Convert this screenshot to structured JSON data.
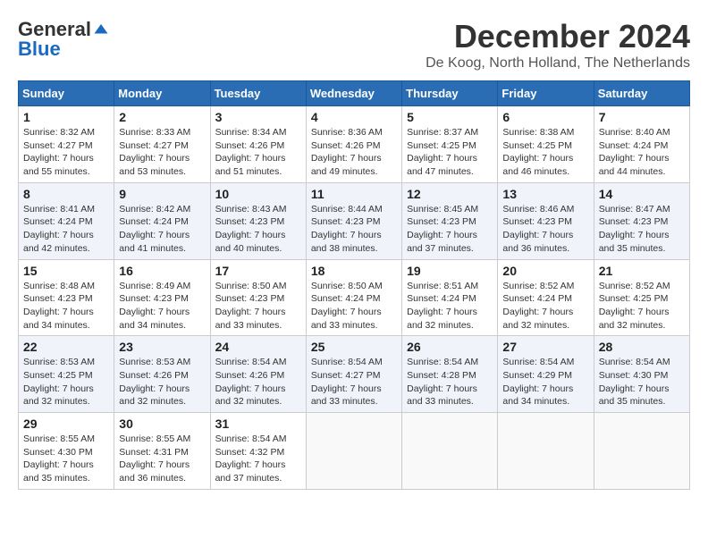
{
  "logo": {
    "general": "General",
    "blue": "Blue"
  },
  "header": {
    "title": "December 2024",
    "subtitle": "De Koog, North Holland, The Netherlands"
  },
  "weekdays": [
    "Sunday",
    "Monday",
    "Tuesday",
    "Wednesday",
    "Thursday",
    "Friday",
    "Saturday"
  ],
  "weeks": [
    [
      {
        "day": "1",
        "sunrise": "8:32 AM",
        "sunset": "4:27 PM",
        "daylight": "7 hours and 55 minutes."
      },
      {
        "day": "2",
        "sunrise": "8:33 AM",
        "sunset": "4:27 PM",
        "daylight": "7 hours and 53 minutes."
      },
      {
        "day": "3",
        "sunrise": "8:34 AM",
        "sunset": "4:26 PM",
        "daylight": "7 hours and 51 minutes."
      },
      {
        "day": "4",
        "sunrise": "8:36 AM",
        "sunset": "4:26 PM",
        "daylight": "7 hours and 49 minutes."
      },
      {
        "day": "5",
        "sunrise": "8:37 AM",
        "sunset": "4:25 PM",
        "daylight": "7 hours and 47 minutes."
      },
      {
        "day": "6",
        "sunrise": "8:38 AM",
        "sunset": "4:25 PM",
        "daylight": "7 hours and 46 minutes."
      },
      {
        "day": "7",
        "sunrise": "8:40 AM",
        "sunset": "4:24 PM",
        "daylight": "7 hours and 44 minutes."
      }
    ],
    [
      {
        "day": "8",
        "sunrise": "8:41 AM",
        "sunset": "4:24 PM",
        "daylight": "7 hours and 42 minutes."
      },
      {
        "day": "9",
        "sunrise": "8:42 AM",
        "sunset": "4:24 PM",
        "daylight": "7 hours and 41 minutes."
      },
      {
        "day": "10",
        "sunrise": "8:43 AM",
        "sunset": "4:23 PM",
        "daylight": "7 hours and 40 minutes."
      },
      {
        "day": "11",
        "sunrise": "8:44 AM",
        "sunset": "4:23 PM",
        "daylight": "7 hours and 38 minutes."
      },
      {
        "day": "12",
        "sunrise": "8:45 AM",
        "sunset": "4:23 PM",
        "daylight": "7 hours and 37 minutes."
      },
      {
        "day": "13",
        "sunrise": "8:46 AM",
        "sunset": "4:23 PM",
        "daylight": "7 hours and 36 minutes."
      },
      {
        "day": "14",
        "sunrise": "8:47 AM",
        "sunset": "4:23 PM",
        "daylight": "7 hours and 35 minutes."
      }
    ],
    [
      {
        "day": "15",
        "sunrise": "8:48 AM",
        "sunset": "4:23 PM",
        "daylight": "7 hours and 34 minutes."
      },
      {
        "day": "16",
        "sunrise": "8:49 AM",
        "sunset": "4:23 PM",
        "daylight": "7 hours and 34 minutes."
      },
      {
        "day": "17",
        "sunrise": "8:50 AM",
        "sunset": "4:23 PM",
        "daylight": "7 hours and 33 minutes."
      },
      {
        "day": "18",
        "sunrise": "8:50 AM",
        "sunset": "4:24 PM",
        "daylight": "7 hours and 33 minutes."
      },
      {
        "day": "19",
        "sunrise": "8:51 AM",
        "sunset": "4:24 PM",
        "daylight": "7 hours and 32 minutes."
      },
      {
        "day": "20",
        "sunrise": "8:52 AM",
        "sunset": "4:24 PM",
        "daylight": "7 hours and 32 minutes."
      },
      {
        "day": "21",
        "sunrise": "8:52 AM",
        "sunset": "4:25 PM",
        "daylight": "7 hours and 32 minutes."
      }
    ],
    [
      {
        "day": "22",
        "sunrise": "8:53 AM",
        "sunset": "4:25 PM",
        "daylight": "7 hours and 32 minutes."
      },
      {
        "day": "23",
        "sunrise": "8:53 AM",
        "sunset": "4:26 PM",
        "daylight": "7 hours and 32 minutes."
      },
      {
        "day": "24",
        "sunrise": "8:54 AM",
        "sunset": "4:26 PM",
        "daylight": "7 hours and 32 minutes."
      },
      {
        "day": "25",
        "sunrise": "8:54 AM",
        "sunset": "4:27 PM",
        "daylight": "7 hours and 33 minutes."
      },
      {
        "day": "26",
        "sunrise": "8:54 AM",
        "sunset": "4:28 PM",
        "daylight": "7 hours and 33 minutes."
      },
      {
        "day": "27",
        "sunrise": "8:54 AM",
        "sunset": "4:29 PM",
        "daylight": "7 hours and 34 minutes."
      },
      {
        "day": "28",
        "sunrise": "8:54 AM",
        "sunset": "4:30 PM",
        "daylight": "7 hours and 35 minutes."
      }
    ],
    [
      {
        "day": "29",
        "sunrise": "8:55 AM",
        "sunset": "4:30 PM",
        "daylight": "7 hours and 35 minutes."
      },
      {
        "day": "30",
        "sunrise": "8:55 AM",
        "sunset": "4:31 PM",
        "daylight": "7 hours and 36 minutes."
      },
      {
        "day": "31",
        "sunrise": "8:54 AM",
        "sunset": "4:32 PM",
        "daylight": "7 hours and 37 minutes."
      },
      null,
      null,
      null,
      null
    ]
  ],
  "labels": {
    "sunrise": "Sunrise: ",
    "sunset": "Sunset: ",
    "daylight": "Daylight: "
  }
}
